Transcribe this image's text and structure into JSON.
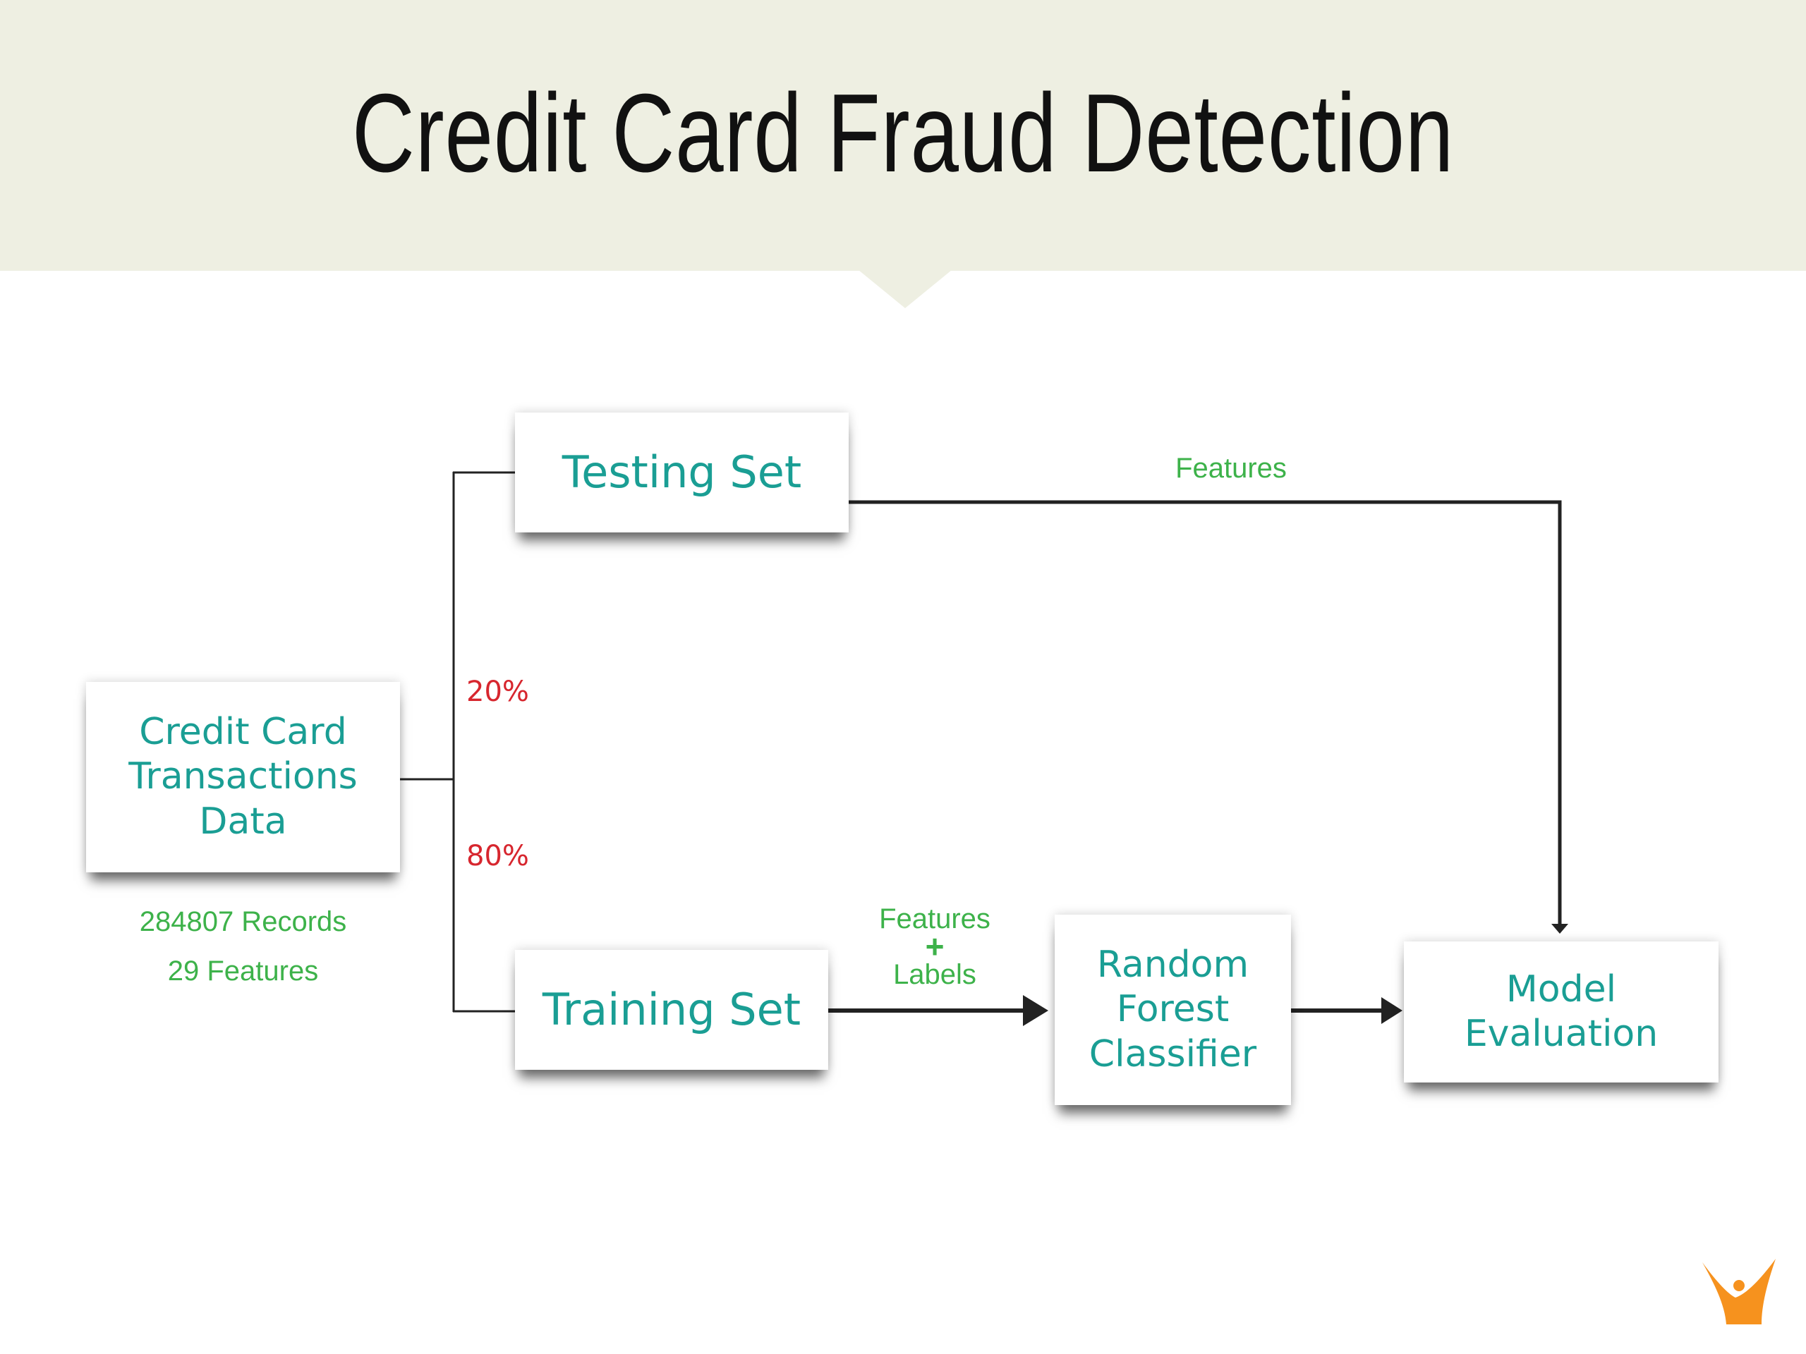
{
  "header": {
    "title": "Credit Card Fraud Detection"
  },
  "nodes": {
    "source": {
      "label": "Credit Card Transactions Data",
      "lines": [
        "Credit Card",
        "Transactions",
        "Data"
      ]
    },
    "testing": {
      "label": "Testing Set"
    },
    "training": {
      "label": "Training Set"
    },
    "classifier": {
      "label": "Random Forest Classifier",
      "lines": [
        "Random",
        "Forest",
        "Classifier"
      ]
    },
    "evaluation": {
      "label": "Model Evaluation",
      "lines": [
        "Model",
        "Evaluation"
      ]
    }
  },
  "source_stats": {
    "records": "284807 Records",
    "features": "29 Features"
  },
  "split": {
    "test_pct": "20%",
    "train_pct": "80%"
  },
  "edges": {
    "testing_to_evaluation": "Features",
    "training_to_classifier": {
      "top": "Features",
      "plus": "+",
      "bottom": "Labels"
    }
  },
  "colors": {
    "header_bg": "#eeefe2",
    "node_text": "#1a9e94",
    "label_green": "#3db24a",
    "pct_red": "#d7262e",
    "logo": "#f6921e"
  },
  "logo": {
    "icon": "person-v-logo-icon"
  }
}
